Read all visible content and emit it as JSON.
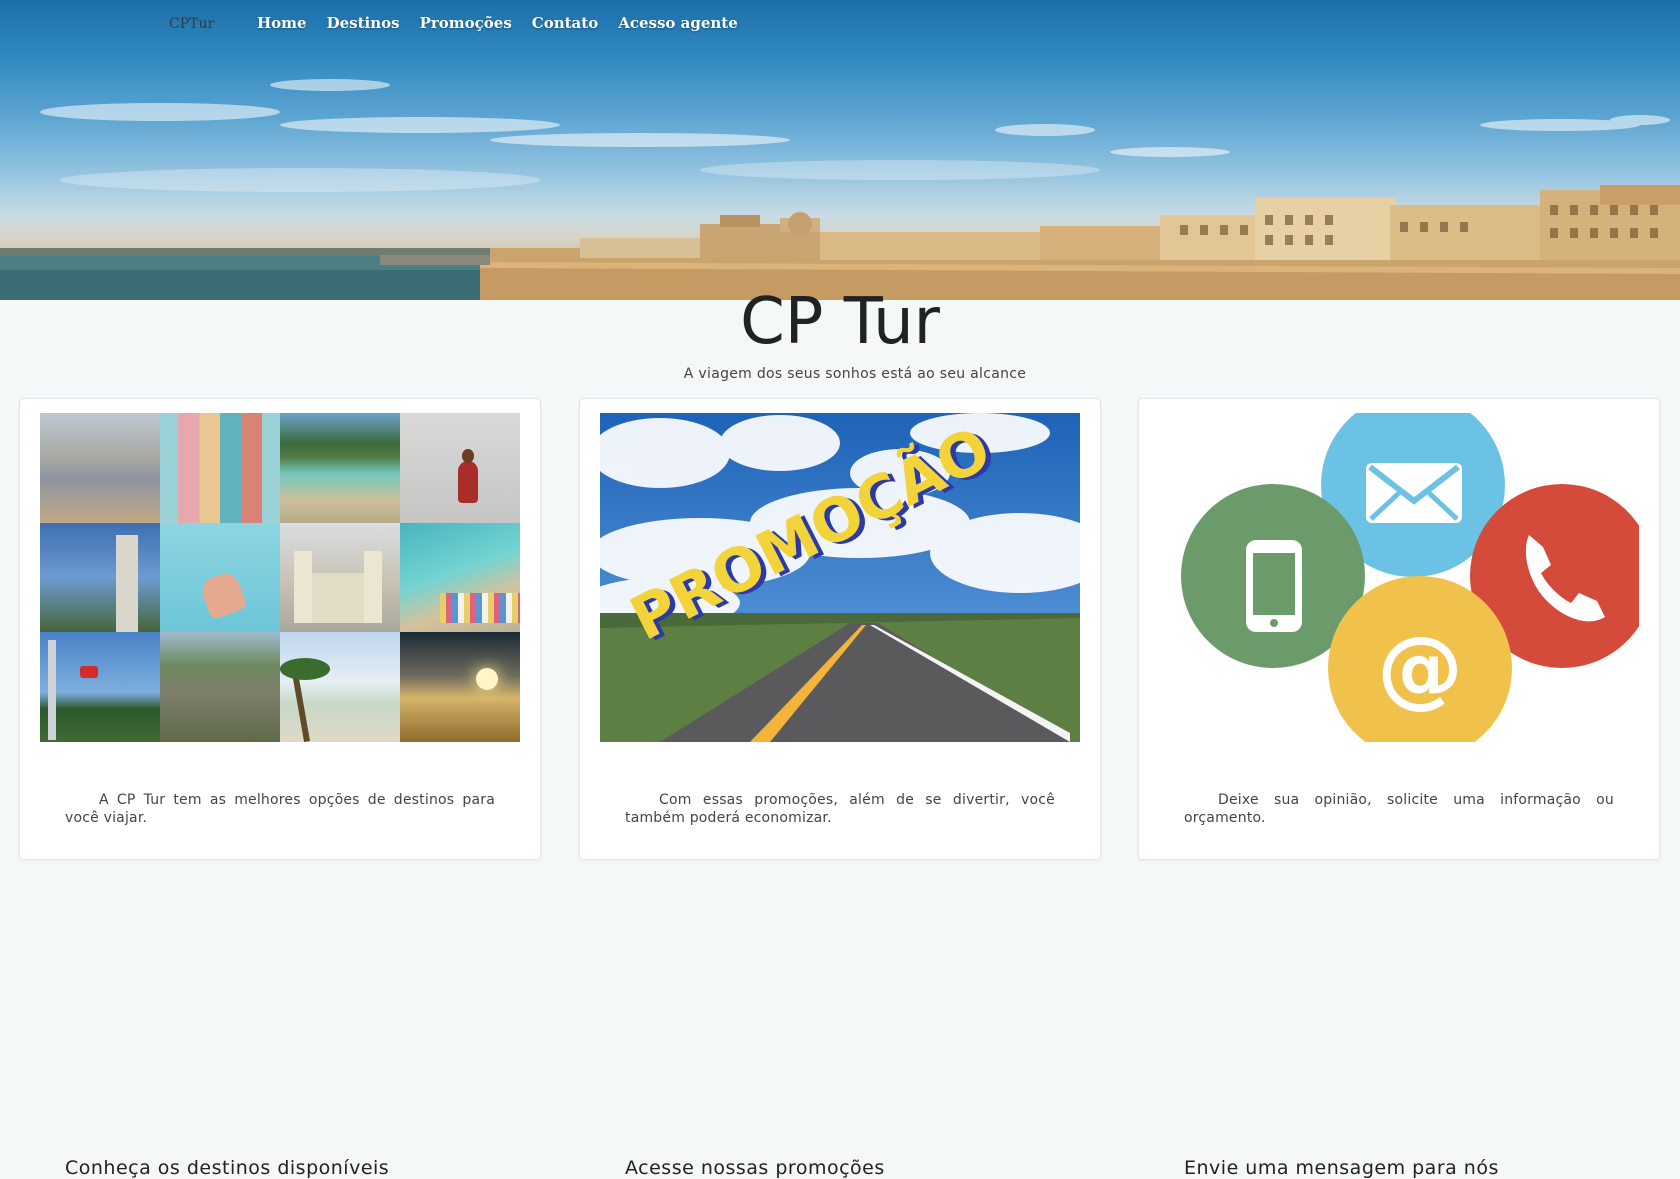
{
  "brand": "CPTur",
  "nav": [
    "Home",
    "Destinos",
    "Promoções",
    "Contato",
    "Acesso agente"
  ],
  "heading": {
    "title": "CP Tur",
    "subtitle": "A viagem dos seus sonhos está ao seu alcance"
  },
  "cards": [
    {
      "title": "Conheça os destinos disponíveis",
      "text": "A CP Tur tem as melhores opções de destinos para você viajar."
    },
    {
      "title": "Acesse nossas promoções",
      "text": "Com essas promoções, além de se divertir, você também poderá economizar.",
      "image_text": "PROMOÇÃO"
    },
    {
      "title": "Envie uma mensagem para nós",
      "text": "Deixe sua opinião, solicite uma informação ou orçamento."
    }
  ],
  "contact_icons": [
    "mail-icon",
    "phone-icon",
    "mobile-icon",
    "at-sign-icon"
  ],
  "colors": {
    "mail": "#6cc2e4",
    "phone": "#d54b3b",
    "mobile": "#6b9b6a",
    "at": "#f0c14b"
  }
}
